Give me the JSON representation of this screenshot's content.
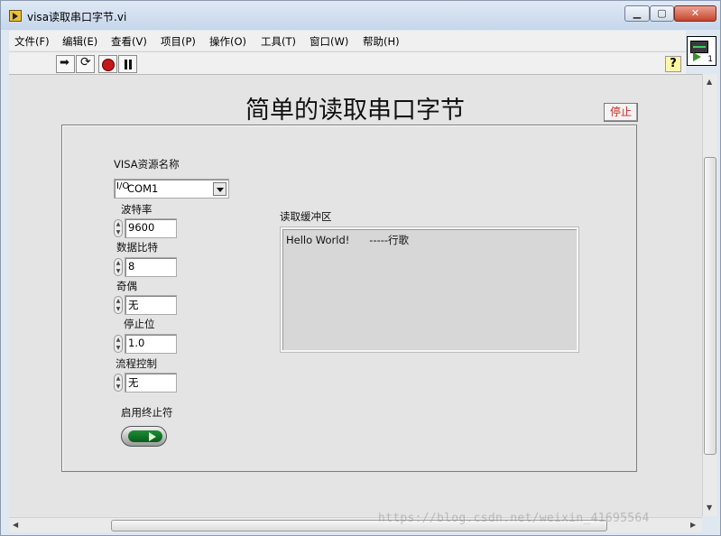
{
  "window": {
    "title": "visa读取串口字节.vi"
  },
  "menu": [
    "文件(F)",
    "编辑(E)",
    "查看(V)",
    "项目(P)",
    "操作(O)",
    "工具(T)",
    "窗口(W)",
    "帮助(H)"
  ],
  "toolbar": {
    "help": "?"
  },
  "vi_icon": {
    "number": "1"
  },
  "panel": {
    "title": "简单的读取串口字节",
    "stop_label": "停止",
    "visa": {
      "label": "VISA资源名称",
      "prefix": "I/O",
      "value": "COM1"
    },
    "baud": {
      "label": "波特率",
      "value": "9600"
    },
    "data_bits": {
      "label": "数据比特",
      "value": "8"
    },
    "parity": {
      "label": "奇偶",
      "value": "无"
    },
    "stop_bits": {
      "label": "停止位",
      "value": "1.0"
    },
    "flow": {
      "label": "流程控制",
      "value": "无"
    },
    "terminator": {
      "label": "启用终止符"
    },
    "buffer": {
      "label": "读取缓冲区",
      "text": "Hello World!      -----行歌"
    }
  },
  "watermark": "https://blog.csdn.net/weixin_41695564"
}
